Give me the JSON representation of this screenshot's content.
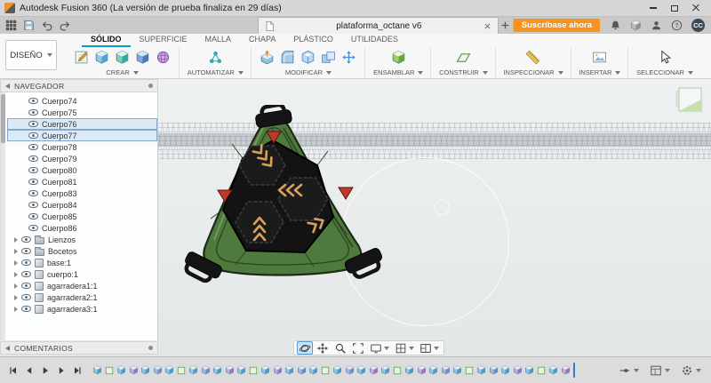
{
  "colors": {
    "accent_orange": "#f6921e",
    "tab_underline": "#0a98d5",
    "selection_blue": "#dce9f7"
  },
  "titlebar": {
    "title": "Autodesk Fusion 360 (La versión de prueba finaliza en 29 días)"
  },
  "appbar": {
    "icons": [
      "app-grid",
      "save",
      "undo",
      "redo"
    ]
  },
  "tabstrip": {
    "document_tab": "plataforma_octane v6",
    "subscribe_button": "Suscríbase ahora",
    "avatar_initials": "CC",
    "right_icons": [
      "bell",
      "box",
      "person",
      "help"
    ]
  },
  "ribbon": {
    "workspace_button": "DISEÑO",
    "tabs": [
      {
        "label": "SÓLIDO",
        "active": true
      },
      {
        "label": "SUPERFICIE",
        "active": false
      },
      {
        "label": "MALLA",
        "active": false
      },
      {
        "label": "CHAPA",
        "active": false
      },
      {
        "label": "PLÁSTICO",
        "active": false
      },
      {
        "label": "UTILIDADES",
        "active": false
      }
    ],
    "groups": [
      {
        "label": "CREAR",
        "icons": [
          "sketch",
          "cube-extrude",
          "cube-revolve",
          "cube-sweep",
          "sphere-form"
        ]
      },
      {
        "label": "AUTOMATIZAR",
        "icons": [
          "automate"
        ]
      },
      {
        "label": "MODIFICAR",
        "icons": [
          "press-pull",
          "fillet",
          "shell",
          "combine",
          "move"
        ]
      },
      {
        "label": "ENSAMBLAR",
        "icons": [
          "assemble"
        ]
      },
      {
        "label": "CONSTRUIR",
        "icons": [
          "construct-plane"
        ]
      },
      {
        "label": "INSPECCIONAR",
        "icons": [
          "measure"
        ]
      },
      {
        "label": "INSERTAR",
        "icons": [
          "insert-canvas"
        ]
      },
      {
        "label": "SELECCIONAR",
        "icons": [
          "select-cursor"
        ]
      }
    ]
  },
  "navigator": {
    "title": "NAVEGADOR",
    "rows": [
      {
        "label": "Cuerpo74",
        "kind": "body",
        "selected": false
      },
      {
        "label": "Cuerpo75",
        "kind": "body",
        "selected": false
      },
      {
        "label": "Cuerpo76",
        "kind": "body",
        "selected": true
      },
      {
        "label": "Cuerpo77",
        "kind": "body",
        "selected": true
      },
      {
        "label": "Cuerpo78",
        "kind": "body",
        "selected": false
      },
      {
        "label": "Cuerpo79",
        "kind": "body",
        "selected": false
      },
      {
        "label": "Cuerpo80",
        "kind": "body",
        "selected": false
      },
      {
        "label": "Cuerpo81",
        "kind": "body",
        "selected": false
      },
      {
        "label": "Cuerpo83",
        "kind": "body",
        "selected": false
      },
      {
        "label": "Cuerpo84",
        "kind": "body",
        "selected": false
      },
      {
        "label": "Cuerpo85",
        "kind": "body",
        "selected": false
      },
      {
        "label": "Cuerpo86",
        "kind": "body",
        "selected": false
      },
      {
        "label": "Lienzos",
        "kind": "folder",
        "selected": false
      },
      {
        "label": "Bocetos",
        "kind": "folder",
        "selected": false
      },
      {
        "label": "base:1",
        "kind": "component",
        "selected": false
      },
      {
        "label": "cuerpo:1",
        "kind": "component",
        "selected": false
      },
      {
        "label": "agarradera1:1",
        "kind": "component",
        "selected": false
      },
      {
        "label": "agarradera2:1",
        "kind": "component",
        "selected": false
      },
      {
        "label": "agarradera3:1",
        "kind": "component",
        "selected": false
      }
    ]
  },
  "comments": {
    "title": "COMENTARIOS"
  },
  "viewbar": {
    "active_icon": "orbit",
    "icons": [
      "orbit",
      "pan",
      "zoom",
      "fit",
      "display-settings",
      "grid-settings",
      "viewports"
    ]
  },
  "timeline": {
    "controls": [
      "skip-start",
      "step-back",
      "play",
      "step-forward",
      "skip-end"
    ],
    "feature_count": 40,
    "right_icons": [
      "slider",
      "layout",
      "gear"
    ]
  }
}
